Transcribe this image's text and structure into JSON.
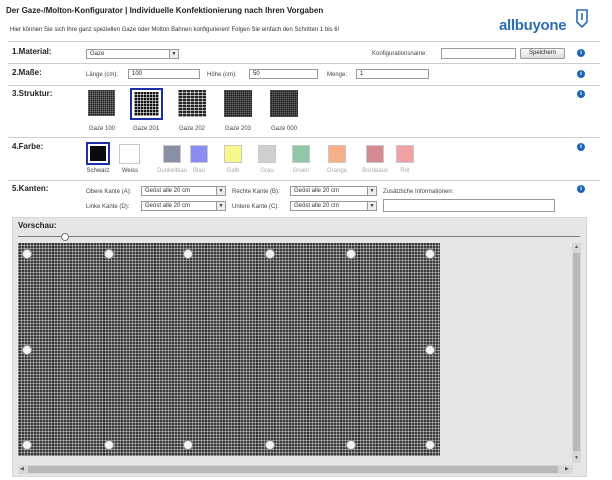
{
  "header": {
    "title": "Der Gaze-/Molton-Konfigurator | Individuelle Konfektionierung nach Ihren Vorgaben",
    "intro": "Hier können Sie sich Ihre ganz speziellen Gaze oder Molton Bahnen konfigurieren! Folgen Sie einfach den Schritten 1 bis 6!",
    "logo_text": "allbuyone"
  },
  "material": {
    "label": "1.Material:",
    "value": "Gaze",
    "config_name_label": "Konfigurationsname:",
    "config_name_value": "",
    "save_label": "Speichern"
  },
  "masse": {
    "label": "2.Maße:",
    "laenge_label": "Länge (cm):",
    "laenge_value": "100",
    "hoehe_label": "Höhe (cm):",
    "hoehe_value": "50",
    "menge_label": "Menge:",
    "menge_value": "1"
  },
  "struktur": {
    "label": "3.Struktur:",
    "items": [
      {
        "label": "Gaze 100",
        "selected": false
      },
      {
        "label": "Gaze 201",
        "selected": true
      },
      {
        "label": "Gaze 202",
        "selected": false
      },
      {
        "label": "Gaze 203",
        "selected": false
      },
      {
        "label": "Gaze 000",
        "selected": false
      }
    ]
  },
  "farbe": {
    "label": "4.Farbe:",
    "items": [
      {
        "label": "Schwarz",
        "color": "#0a0a0a",
        "selected": true
      },
      {
        "label": "Weiss",
        "color": "#ffffff",
        "selected": false
      },
      {
        "label": "Dunkelblau",
        "color": "#8a8fa8",
        "selected": false
      },
      {
        "label": "Blau",
        "color": "#8c8cf4",
        "selected": false
      },
      {
        "label": "Gelb",
        "color": "#f8f88a",
        "selected": false
      },
      {
        "label": "Grau",
        "color": "#cfcfcf",
        "selected": false
      },
      {
        "label": "Gruen",
        "color": "#8fc7a7",
        "selected": false
      },
      {
        "label": "Orange",
        "color": "#f5b08a",
        "selected": false
      },
      {
        "label": "Bordeaux",
        "color": "#d48a92",
        "selected": false
      },
      {
        "label": "Rot",
        "color": "#f1a0a4",
        "selected": false
      }
    ]
  },
  "kanten": {
    "label": "5.Kanten:",
    "obere_label": "Obere Kante (A):",
    "obere_value": "Geöst alle 20 cm",
    "rechte_label": "Rechte Kante (B):",
    "rechte_value": "Geöst alle 20 cm",
    "linke_label": "Linke Kante (D):",
    "linke_value": "Geöst alle 20 cm",
    "untere_label": "Untere Kante (C):",
    "untere_value": "Geöst alle 20 cm",
    "info_label": "Zusätzliche Informationen:",
    "info_value": ""
  },
  "vorschau": {
    "label": "Vorschau:"
  },
  "icons": {
    "info": "info-icon",
    "dropdown": "chevron-down-icon",
    "logo": "allbuyone-logo"
  },
  "colors": {
    "accent": "#1c64b8",
    "selection": "#1a2fa8"
  }
}
